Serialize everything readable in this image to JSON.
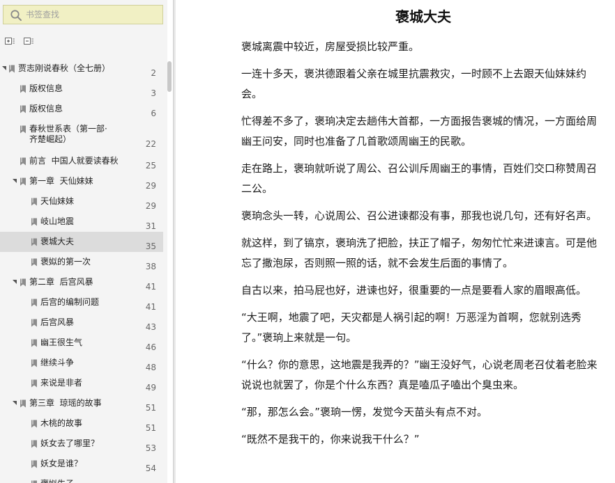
{
  "search": {
    "placeholder": "书签查找"
  },
  "toc": [
    {
      "label": "贾志刚说春秋（全七册）",
      "page": "2",
      "level": 0,
      "expanded": true
    },
    {
      "label": "版权信息",
      "page": "3",
      "level": 1
    },
    {
      "label": "版权信息",
      "page": "6",
      "level": 1
    },
    {
      "label": "春秋世系表（第一部·\n齐楚崛起）",
      "page": "22",
      "level": 1
    },
    {
      "label": "前言  中国人就要读春秋",
      "page": "25",
      "level": 1
    },
    {
      "label": "第一章  天仙妹妹",
      "page": "29",
      "level": 1,
      "expanded": true
    },
    {
      "label": "天仙妹妹",
      "page": "29",
      "level": 2
    },
    {
      "label": "岐山地震",
      "page": "31",
      "level": 2
    },
    {
      "label": "褒城大夫",
      "page": "35",
      "level": 2,
      "selected": true
    },
    {
      "label": "褒姒的第一次",
      "page": "38",
      "level": 2
    },
    {
      "label": "第二章  后宫风暴",
      "page": "41",
      "level": 1,
      "expanded": true
    },
    {
      "label": "后宫的编制问题",
      "page": "41",
      "level": 2
    },
    {
      "label": "后宫风暴",
      "page": "43",
      "level": 2
    },
    {
      "label": "幽王很生气",
      "page": "46",
      "level": 2
    },
    {
      "label": "继续斗争",
      "page": "48",
      "level": 2
    },
    {
      "label": "来说是非者",
      "page": "49",
      "level": 2
    },
    {
      "label": "第三章  琼瑶的故事",
      "page": "51",
      "level": 1,
      "expanded": true
    },
    {
      "label": "木桃的故事",
      "page": "51",
      "level": 2
    },
    {
      "label": "妖女去了哪里？",
      "page": "53",
      "level": 2
    },
    {
      "label": "妖女是谁？",
      "page": "54",
      "level": 2
    },
    {
      "label": "褒姒生子",
      "page": "",
      "level": 2
    }
  ],
  "reader": {
    "title": "褒城大夫",
    "paragraphs": [
      "褒城离震中较近，房屋受损比较严重。",
      "一连十多天，褒洪德跟着父亲在城里抗震救灾，一时顾不上去跟天仙妹妹约会。",
      "忙得差不多了，褒珦决定去趟伟大首都，一方面报告褒城的情况，一方面给周幽王问安，同时也准备了几首歌颂周幽王的民歌。",
      "走在路上，褒珦就听说了周公、召公训斥周幽王的事情，百姓们交口称赞周召二公。",
      "褒珦念头一转，心说周公、召公进谏都没有事，那我也说几句，还有好名声。",
      "就这样，到了镐京，褒珦洗了把脸，扶正了帽子，匆匆忙忙来进谏言。可是他忘了撒泡尿，否则照一照的话，就不会发生后面的事情了。",
      "自古以来，拍马屁也好，进谏也好，很重要的一点是要看人家的眉眼高低。",
      "“大王啊，地震了吧，天灾都是人祸引起的啊！万恶淫为首啊，您就别选秀了。”褒珦上来就是一句。",
      "“什么？你的意思，这地震是我弄的？”幽王没好气，心说老周老召仗着老脸来说说也就罢了，你是个什么东西？真是嗑瓜子嗑出个臭虫来。",
      "“那，那怎么会。”褒珦一愣，发觉今天苗头有点不对。",
      "“既然不是我干的，你来说我干什么？”"
    ]
  },
  "colors": {
    "sidebar_bg": "#f4f4f4",
    "search_bg": "#f1f0c4",
    "selected_bg": "#dcdcdc"
  }
}
